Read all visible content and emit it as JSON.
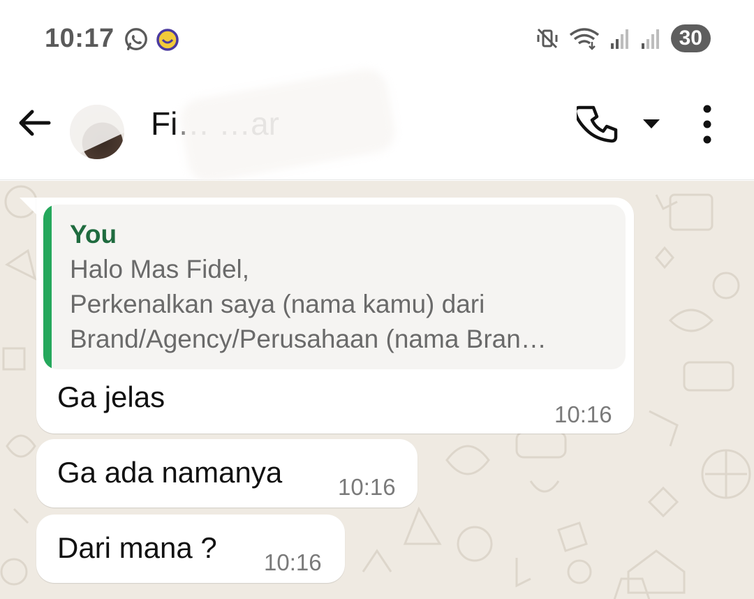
{
  "status_bar": {
    "time": "10:17",
    "battery": "30",
    "icons": [
      "whatsapp-notification-icon",
      "smiley-notification-icon",
      "vibrate-mute-icon",
      "wifi-icon",
      "signal-1-icon",
      "signal-2-icon"
    ]
  },
  "header": {
    "contact_name": "Fi…   …ar",
    "icons": [
      "back-arrow-icon",
      "phone-icon",
      "dropdown-caret-icon",
      "more-vert-icon"
    ]
  },
  "messages": [
    {
      "quoted": {
        "author": "You",
        "lines": [
          "Halo Mas Fidel,",
          "Perkenalkan saya (nama kamu) dari",
          "Brand/Agency/Perusahaan (nama Bran…"
        ]
      },
      "text": "Ga jelas",
      "time": "10:16"
    },
    {
      "text": "Ga ada namanya",
      "time": "10:16"
    },
    {
      "text": "Dari mana ?",
      "time": "10:16"
    }
  ],
  "colors": {
    "chat_background": "#efeae2",
    "quote_bar": "#25a85c",
    "quote_author": "#1f6b3f",
    "bubble": "#ffffff"
  }
}
